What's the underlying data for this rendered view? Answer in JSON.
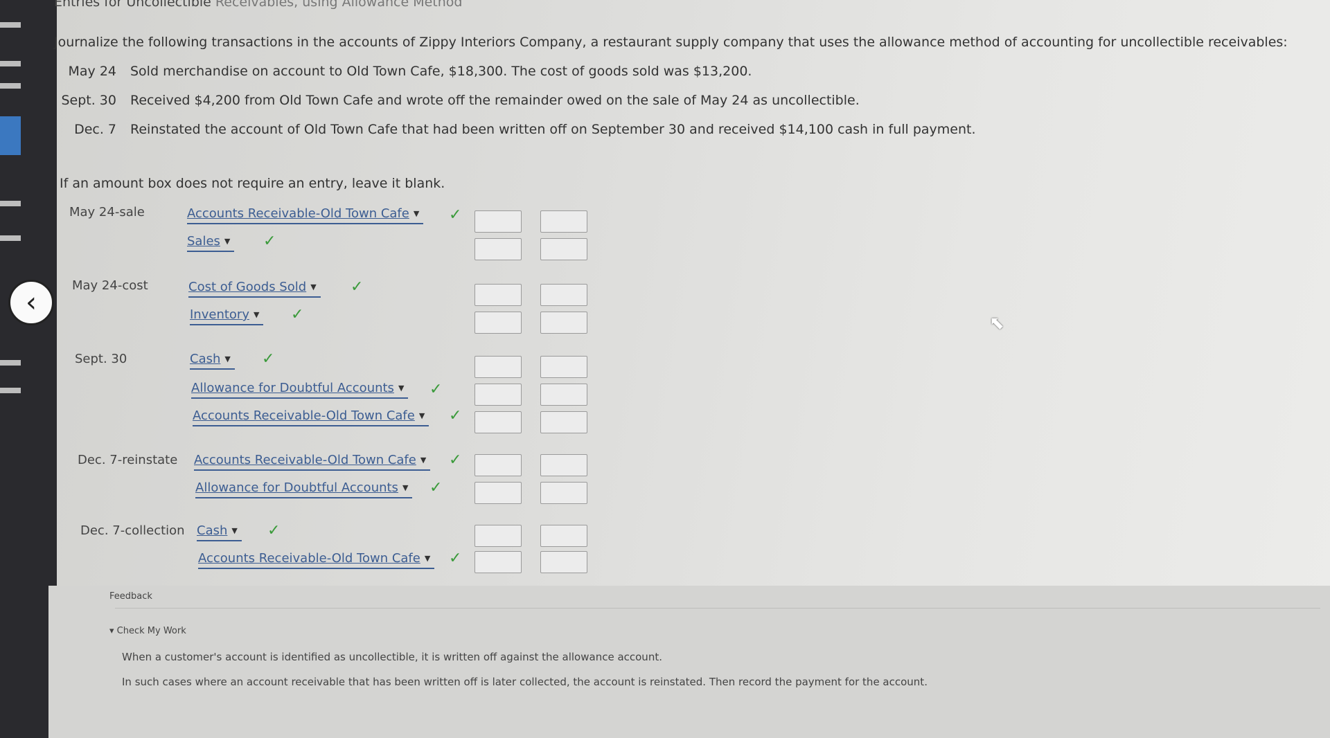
{
  "page": {
    "title_prefix": "Entries for Uncollectible",
    "title_suffix": "Receivables, using Allowance Method",
    "intro": "Journalize the following transactions in the accounts of Zippy Interiors Company, a restaurant supply company that uses the allowance method of accounting for uncollectible receivables:",
    "transactions": [
      {
        "date": "May 24",
        "text": "Sold merchandise on account to Old Town Cafe, $18,300. The cost of goods sold was $13,200."
      },
      {
        "date": "Sept. 30",
        "text": "Received $4,200 from Old Town Cafe and wrote off the remainder owed on the sale of May 24 as uncollectible."
      },
      {
        "date": "Dec. 7",
        "text": "Reinstated the account of Old Town Cafe that had been written off on September 30 and received $14,100 cash in full payment."
      }
    ],
    "hint": "If an amount box does not require an entry, leave it blank."
  },
  "entries": [
    {
      "label": "May 24-sale",
      "lines": [
        {
          "account": "Accounts Receivable-Old Town Cafe",
          "debit": "",
          "credit": ""
        },
        {
          "account": "Sales",
          "debit": "",
          "credit": ""
        }
      ]
    },
    {
      "label": "May 24-cost",
      "lines": [
        {
          "account": "Cost of Goods Sold",
          "debit": "",
          "credit": ""
        },
        {
          "account": "Inventory",
          "debit": "",
          "credit": ""
        }
      ]
    },
    {
      "label": "Sept. 30",
      "lines": [
        {
          "account": "Cash",
          "debit": "",
          "credit": ""
        },
        {
          "account": "Allowance for Doubtful Accounts",
          "debit": "",
          "credit": ""
        },
        {
          "account": "Accounts Receivable-Old Town Cafe",
          "debit": "",
          "credit": ""
        }
      ]
    },
    {
      "label": "Dec. 7-reinstate",
      "lines": [
        {
          "account": "Accounts Receivable-Old Town Cafe",
          "debit": "",
          "credit": ""
        },
        {
          "account": "Allowance for Doubtful Accounts",
          "debit": "",
          "credit": ""
        }
      ]
    },
    {
      "label": "Dec. 7-collection",
      "lines": [
        {
          "account": "Cash",
          "debit": "",
          "credit": ""
        },
        {
          "account": "Accounts Receivable-Old Town Cafe",
          "debit": "",
          "credit": ""
        }
      ]
    }
  ],
  "check_mark": "✓",
  "feedback": {
    "label": "Feedback",
    "check_my_work": "Check My Work",
    "text1": "When a customer's account is identified as uncollectible, it is written off against the allowance account.",
    "text2": "In such cases where an account receivable that has been written off is later collected, the account is reinstated. Then record the payment for the account."
  },
  "icons": {
    "back": "chevron-left-icon",
    "dropdown": "caret-down-icon",
    "check": "checkmark-icon",
    "cursor": "mouse-pointer-icon"
  },
  "colors": {
    "link": "#3c5d92",
    "check": "#3a9a3a",
    "sidebar": "#2a2a2e",
    "sidebar_accent": "#3b78c0"
  }
}
